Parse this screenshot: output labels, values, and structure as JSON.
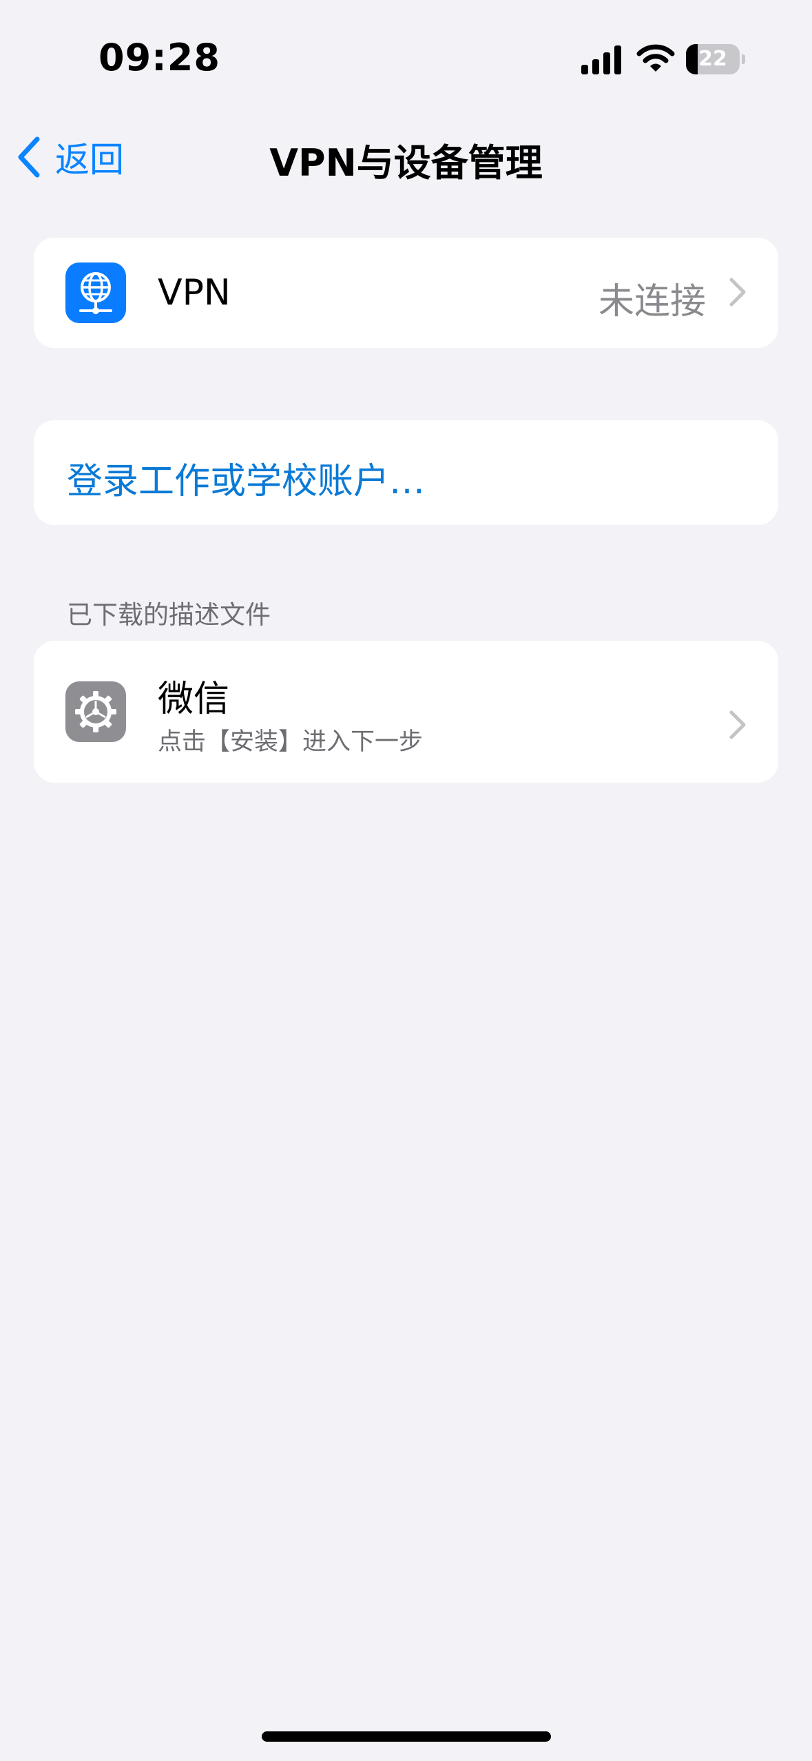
{
  "status_bar": {
    "time": "09:28",
    "battery_level": "22",
    "battery_fraction": 0.22,
    "signal_icon": "cellular-signal-icon",
    "wifi_icon": "wifi-icon"
  },
  "nav": {
    "back_label": "返回",
    "back_icon": "chevron-left-icon",
    "title": "VPN与设备管理"
  },
  "vpn_row": {
    "icon": "globe-network-icon",
    "label": "VPN",
    "status": "未连接"
  },
  "signin": {
    "label": "登录工作或学校账户…"
  },
  "profiles": {
    "header": "已下载的描述文件",
    "items": [
      {
        "icon": "settings-gear-icon",
        "name": "微信",
        "subtitle": "点击【安装】进入下一步"
      }
    ]
  },
  "colors": {
    "accent": "#0a84ff",
    "background": "#f2f2f7",
    "secondary_text": "#8a8a8e"
  }
}
